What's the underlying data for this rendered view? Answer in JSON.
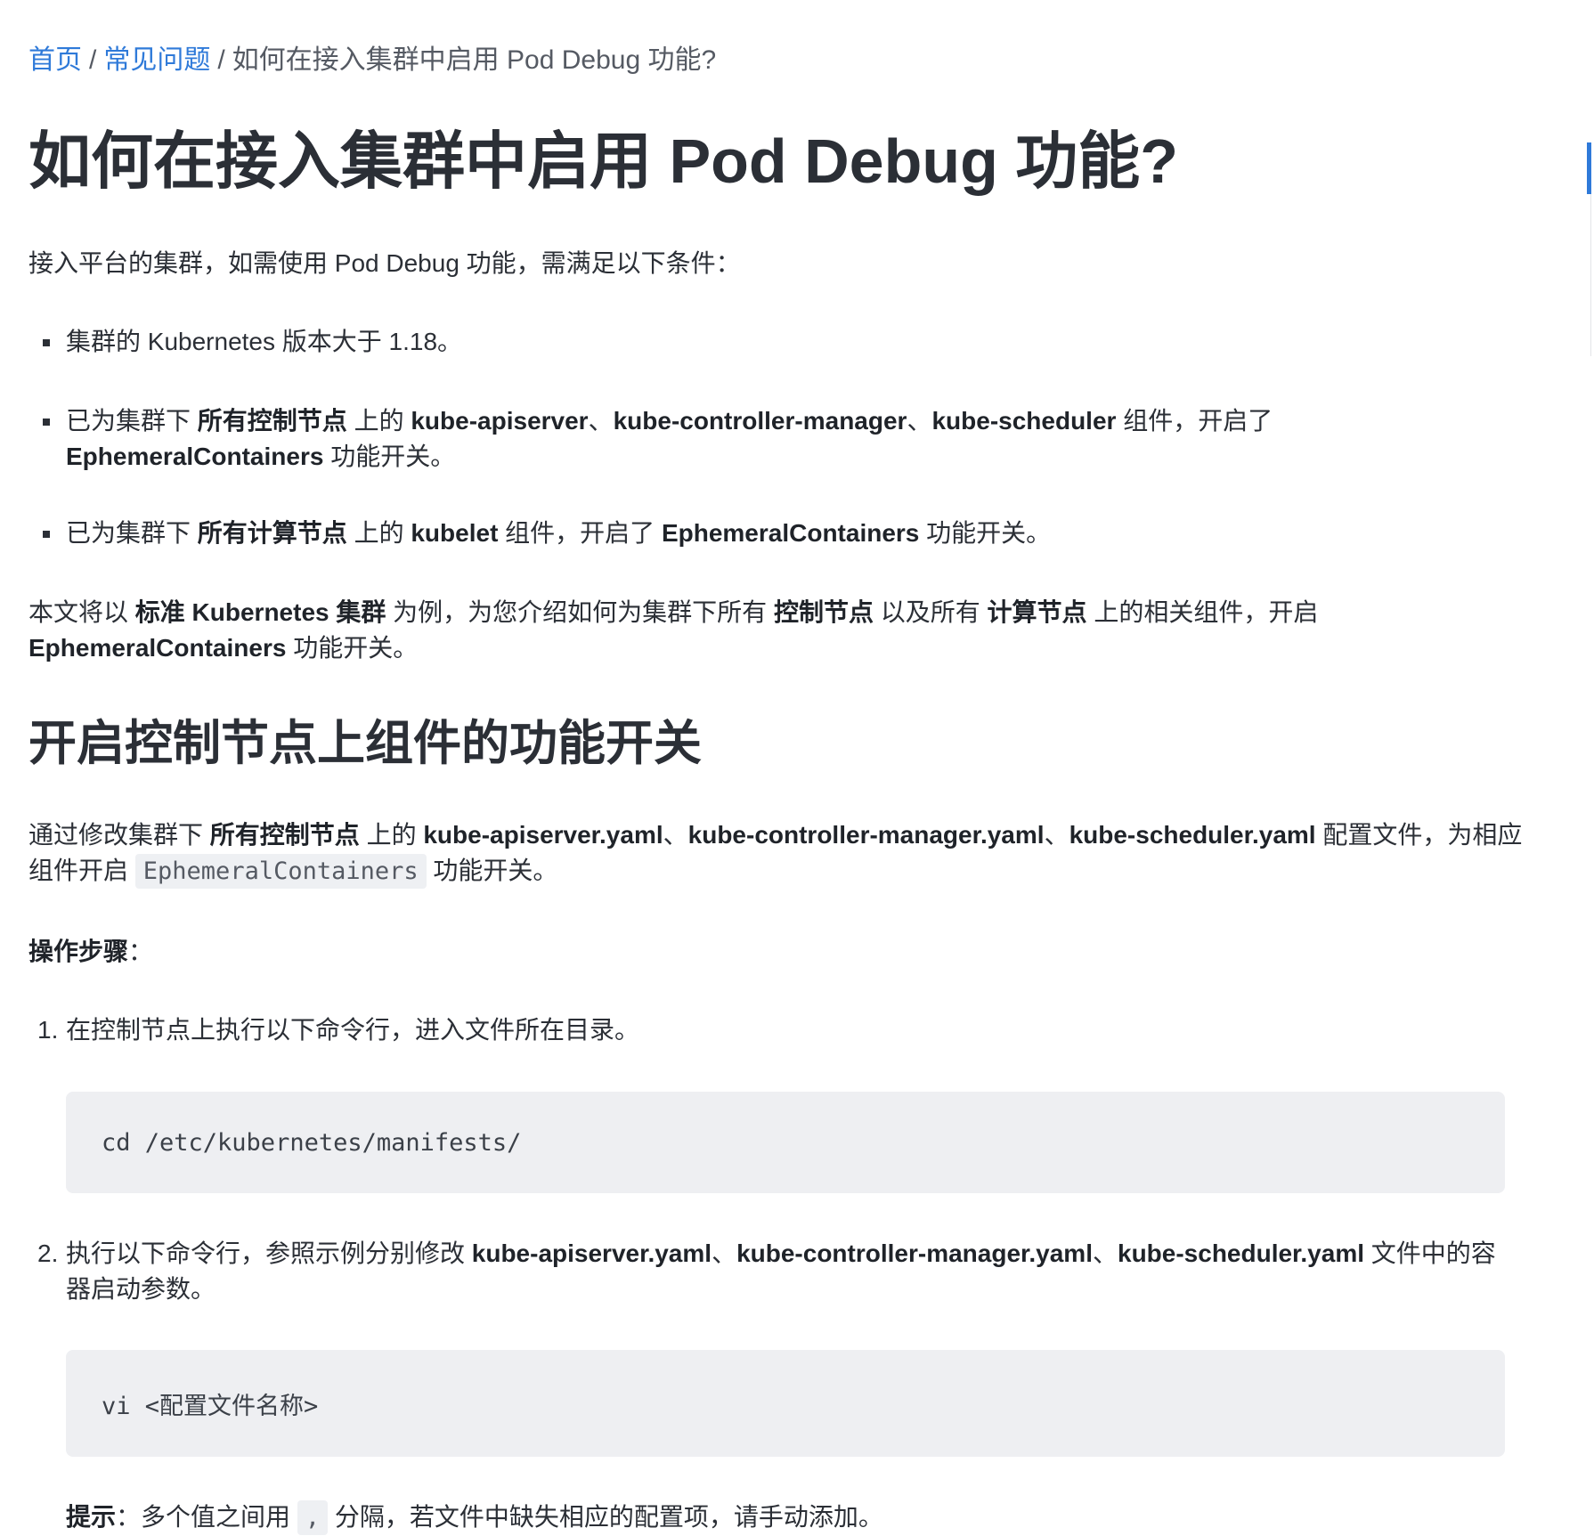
{
  "breadcrumb": {
    "home": "首页",
    "faq": "常见问题",
    "current": "如何在接入集群中启用 Pod Debug 功能?",
    "separator": "/"
  },
  "title": "如何在接入集群中启用 Pod Debug 功能?",
  "intro": "接入平台的集群，如需使用 Pod Debug 功能，需满足以下条件：",
  "conditions": [
    {
      "t1": "集群的 Kubernetes 版本大于 1.18。"
    },
    {
      "t1": "已为集群下 ",
      "b1": "所有控制节点",
      "t2": " 上的 ",
      "b2": "kube-apiserver",
      "t3": "、",
      "b3": "kube-controller-manager",
      "t4": "、",
      "b4": "kube-scheduler",
      "t5": " 组件，开启了",
      "b5": "EphemeralContainers",
      "t6": " 功能开关。"
    },
    {
      "t1": "已为集群下 ",
      "b1": "所有计算节点",
      "t2": " 上的 ",
      "b2": "kubelet",
      "t3": " 组件，开启了 ",
      "b3": "EphemeralContainers",
      "t4": " 功能开关。"
    }
  ],
  "summary": {
    "t1": "本文将以 ",
    "b1": "标准 Kubernetes 集群",
    "t2": " 为例，为您介绍如何为集群下所有 ",
    "b2": "控制节点",
    "t3": " 以及所有 ",
    "b3": "计算节点",
    "t4": " 上的相关组件，开启",
    "b4": "EphemeralContainers",
    "t5": " 功能开关。"
  },
  "section_heading": "开启控制节点上组件的功能开关",
  "section_intro": {
    "t1": "通过修改集群下 ",
    "b1": "所有控制节点",
    "t2": " 上的 ",
    "b2": "kube-apiserver.yaml",
    "t3": "、",
    "b3": "kube-controller-manager.yaml",
    "t4": "、",
    "b4": "kube-scheduler.yaml",
    "t5": " 配置文件，为相应组件开启 ",
    "code": "EphemeralContainers",
    "t6": " 功能开关。"
  },
  "steps_label": "操作步骤",
  "steps_colon": "：",
  "steps": [
    {
      "num": "1.",
      "text": "在控制节点上执行以下命令行，进入文件所在目录。",
      "code": "cd /etc/kubernetes/manifests/"
    },
    {
      "num": "2.",
      "t1": "执行以下命令行，参照示例分别修改 ",
      "b1": "kube-apiserver.yaml",
      "t2": "、",
      "b2": "kube-controller-manager.yaml",
      "t3": "、",
      "b3": "kube-scheduler.yaml",
      "t4": " 文件中的容器启动参数。",
      "code": "vi <配置文件名称>"
    }
  ],
  "tip": {
    "label": "提示",
    "colon": "：",
    "t1": "多个值之间用 ",
    "code": ",",
    "t2": " 分隔，若文件中缺失相应的配置项，请手动添加。"
  }
}
